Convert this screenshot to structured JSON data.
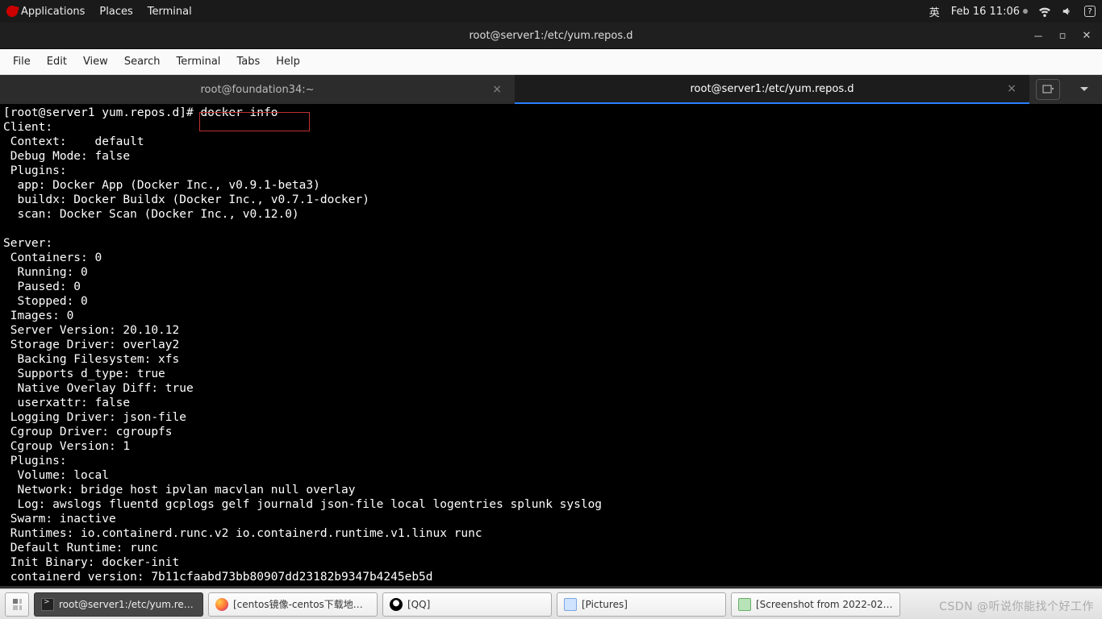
{
  "top_panel": {
    "apps": "Applications",
    "places": "Places",
    "terminal": "Terminal",
    "ime": "英",
    "clock": "Feb 16  11:06"
  },
  "window": {
    "title": "root@server1:/etc/yum.repos.d"
  },
  "menubar": [
    "File",
    "Edit",
    "View",
    "Search",
    "Terminal",
    "Tabs",
    "Help"
  ],
  "tabs": [
    {
      "label": "root@foundation34:~",
      "active": false
    },
    {
      "label": "root@server1:/etc/yum.repos.d",
      "active": true
    }
  ],
  "terminal": {
    "prompt": "[root@server1 yum.repos.d]# ",
    "command": "docker info",
    "output": "Client:\n Context:    default\n Debug Mode: false\n Plugins:\n  app: Docker App (Docker Inc., v0.9.1-beta3)\n  buildx: Docker Buildx (Docker Inc., v0.7.1-docker)\n  scan: Docker Scan (Docker Inc., v0.12.0)\n\nServer:\n Containers: 0\n  Running: 0\n  Paused: 0\n  Stopped: 0\n Images: 0\n Server Version: 20.10.12\n Storage Driver: overlay2\n  Backing Filesystem: xfs\n  Supports d_type: true\n  Native Overlay Diff: true\n  userxattr: false\n Logging Driver: json-file\n Cgroup Driver: cgroupfs\n Cgroup Version: 1\n Plugins:\n  Volume: local\n  Network: bridge host ipvlan macvlan null overlay\n  Log: awslogs fluentd gcplogs gelf journald json-file local logentries splunk syslog\n Swarm: inactive\n Runtimes: io.containerd.runc.v2 io.containerd.runtime.v1.linux runc\n Default Runtime: runc\n Init Binary: docker-init\n containerd version: 7b11cfaabd73bb80907dd23182b9347b4245eb5d"
  },
  "taskbar": {
    "items": [
      {
        "id": "terminal",
        "label": "root@server1:/etc/yum.rep…"
      },
      {
        "id": "firefox",
        "label": "[centos镜像-centos下载地…"
      },
      {
        "id": "qq",
        "label": "[QQ]"
      },
      {
        "id": "pictures",
        "label": "[Pictures]"
      },
      {
        "id": "screenshot",
        "label": "[Screenshot from 2022-02…"
      }
    ]
  },
  "watermark": "CSDN @听说你能找个好工作"
}
